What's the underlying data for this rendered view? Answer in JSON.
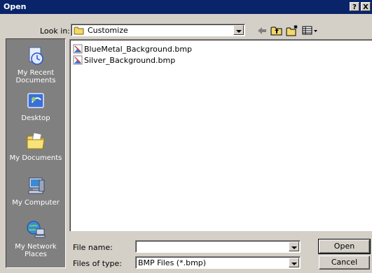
{
  "window": {
    "title": "Open",
    "help_label": "?",
    "close_label": "X"
  },
  "look_in": {
    "label": "Look in:",
    "value": "Customize"
  },
  "toolbar": {
    "icons": [
      "back-arrow-icon",
      "up-one-level-icon",
      "new-folder-icon",
      "view-menu-icon"
    ]
  },
  "places": [
    {
      "label": "My Recent Documents",
      "icon": "recent-documents-icon"
    },
    {
      "label": "Desktop",
      "icon": "desktop-icon"
    },
    {
      "label": "My Documents",
      "icon": "my-documents-icon"
    },
    {
      "label": "My Computer",
      "icon": "my-computer-icon"
    },
    {
      "label": "My Network Places",
      "icon": "network-places-icon"
    }
  ],
  "files": [
    {
      "name": "BlueMetal_Background.bmp"
    },
    {
      "name": "Silver_Background.bmp"
    }
  ],
  "file_name": {
    "label": "File name:",
    "value": ""
  },
  "file_type": {
    "label": "Files of type:",
    "value": "BMP Files (*.bmp)"
  },
  "buttons": {
    "open": "Open",
    "cancel": "Cancel"
  },
  "colors": {
    "titlebar": "#0a246a",
    "face": "#d4d0c8",
    "places_bg": "#808080"
  }
}
